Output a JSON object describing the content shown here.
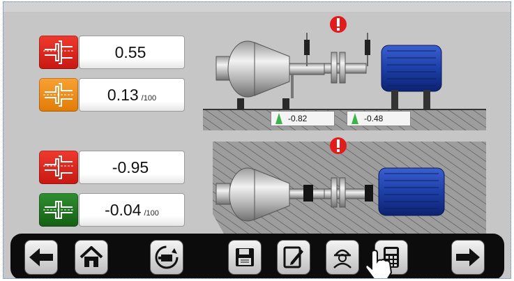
{
  "colors": {
    "screen_bg": "#c6c6c6",
    "red_indicator": "#e0221a",
    "orange_indicator": "#f18a12",
    "green_indicator": "#1f7a1f",
    "motor_blue": "#1d3fa8",
    "alert_red": "#e21b1b",
    "toolbar_bg": "#0c0c0c"
  },
  "top_section": {
    "offset": {
      "value": "0.55",
      "unit": "",
      "status_color": "red"
    },
    "angle": {
      "value": "0.13",
      "unit": "/100",
      "status_color": "orange"
    },
    "foot_readings": [
      "-0.82",
      "-0.48"
    ],
    "alert_icon": "exclamation-alert-icon"
  },
  "bottom_section": {
    "offset": {
      "value": "-0.95",
      "unit": "",
      "status_color": "red"
    },
    "angle": {
      "value": "-0.04",
      "unit": "/100",
      "status_color": "green"
    },
    "alert_icon": "exclamation-alert-icon"
  },
  "toolbar": {
    "buttons": [
      {
        "id": "back",
        "icon": "arrow-left-icon"
      },
      {
        "id": "home",
        "icon": "home-icon"
      },
      {
        "id": "rotate-view",
        "icon": "rotate-machine-icon"
      },
      {
        "id": "save",
        "icon": "floppy-disk-icon"
      },
      {
        "id": "edit",
        "icon": "pencil-note-icon"
      },
      {
        "id": "operator",
        "icon": "worker-helmet-icon"
      },
      {
        "id": "calculator",
        "icon": "calculator-icon"
      },
      {
        "id": "next",
        "icon": "arrow-right-icon"
      }
    ]
  }
}
